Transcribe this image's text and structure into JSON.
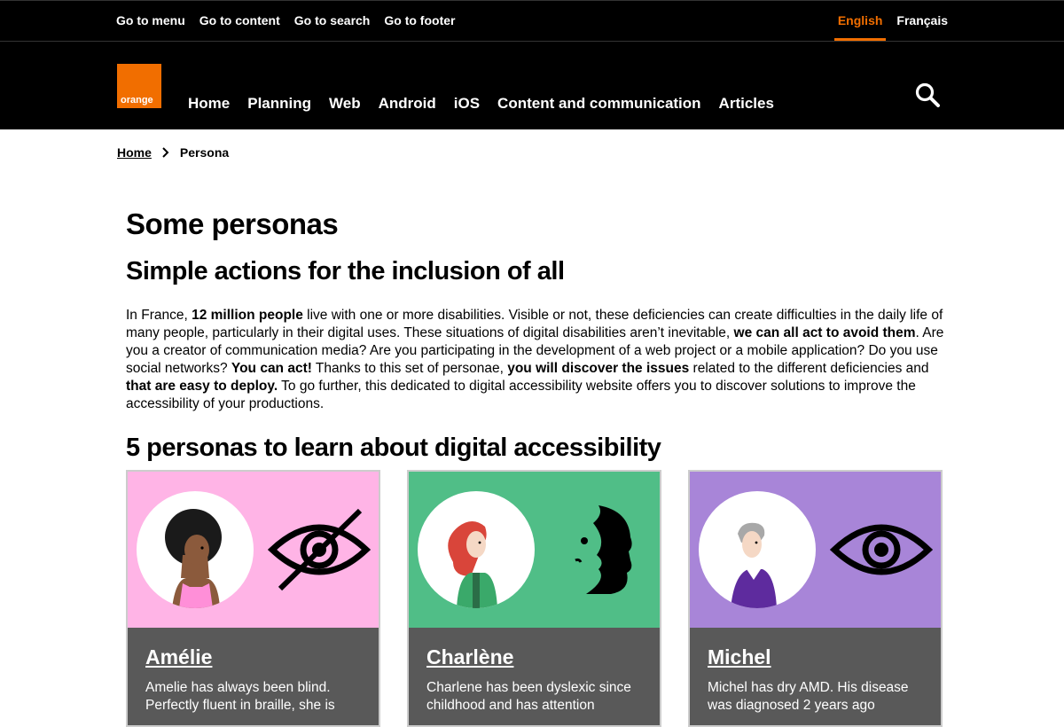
{
  "skip_links": [
    "Go to menu",
    "Go to content",
    "Go to search",
    "Go to footer"
  ],
  "languages": {
    "english": "English",
    "french": "Français"
  },
  "logo_text": "orange",
  "nav": [
    "Home",
    "Planning",
    "Web",
    "Android",
    "iOS",
    "Content and communication",
    "Articles"
  ],
  "breadcrumb": {
    "home": "Home",
    "current": "Persona"
  },
  "page_title": "Some personas",
  "subtitle": "Simple actions for the inclusion of all",
  "intro": {
    "t1": "In France, ",
    "b1": "12 million people",
    "t2": " live with one or more disabilities. Visible or not, these deficiencies can create difficulties in the daily life of many people, particularly in their digital uses. These situations of digital disabilities aren’t inevitable, ",
    "b2": "we can all act to avoid them",
    "t3": ". Are you a creator of communication media? Are you participating in the development of a web project or a mobile application? Do you use social networks? ",
    "b3": "You can act!",
    "t4": " Thanks to this set of personae, ",
    "b4": "you will discover the issues",
    "t5": " related to the different deficiencies and ",
    "b5": "that are easy to deploy.",
    "t6": " To go further, this dedicated to digital accessibility website offers you to discover solutions to improve the accessibility of your productions."
  },
  "section_title": "5 personas to learn about digital accessibility",
  "cards": [
    {
      "name": "Amélie",
      "desc": "Amelie has always been blind. Perfectly fluent in braille, she is",
      "bg": "#ffb4e6",
      "symbol": "eye-slash-icon"
    },
    {
      "name": "Charlène",
      "desc": "Charlene has been dyslexic since childhood and has attention",
      "bg": "#50be87",
      "symbol": "face-profile-icon"
    },
    {
      "name": "Michel",
      "desc": "Michel has dry AMD. His disease was diagnosed 2 years ago",
      "bg": "#a885d8",
      "symbol": "eye-icon"
    }
  ],
  "colors": {
    "brand": "#f16e00",
    "header_bg": "#000000",
    "card_footer": "#595959"
  }
}
